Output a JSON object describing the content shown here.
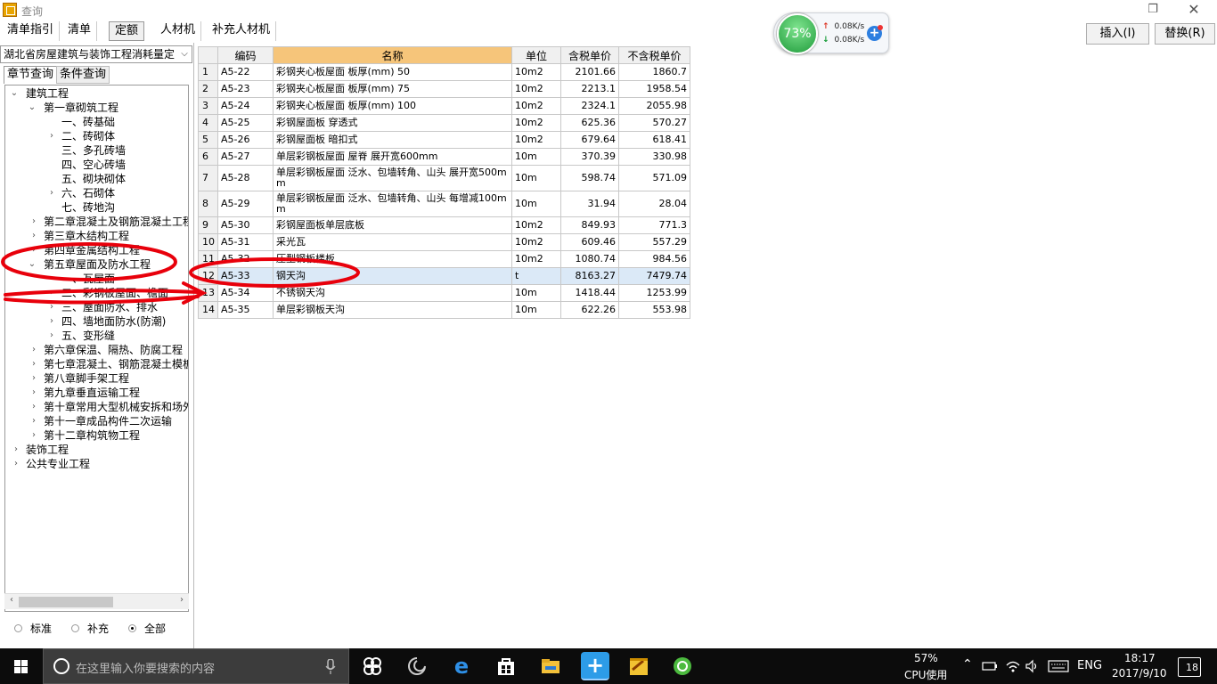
{
  "window": {
    "title": "查询"
  },
  "tabs": [
    {
      "label": "清单指引"
    },
    {
      "label": "清单"
    },
    {
      "label": "定额"
    },
    {
      "label": "人材机"
    },
    {
      "label": "补充人材机"
    }
  ],
  "actions": {
    "insert": "插入(I)",
    "replace": "替换(R)"
  },
  "net_widget": {
    "cpu_percent": "73%",
    "upload": "0.08K/s",
    "download": "0.08K/s"
  },
  "left_panel": {
    "library": "湖北省房屋建筑与装饰工程消耗量定",
    "subtabs": [
      "章节查询",
      "条件查询"
    ],
    "tree": [
      {
        "label": "建筑工程"
      },
      {
        "label": "第一章砌筑工程"
      },
      {
        "label": "一、砖基础"
      },
      {
        "label": "二、砖砌体"
      },
      {
        "label": "三、多孔砖墙"
      },
      {
        "label": "四、空心砖墙"
      },
      {
        "label": "五、砌块砌体"
      },
      {
        "label": "六、石砌体"
      },
      {
        "label": "七、砖地沟"
      },
      {
        "label": "第二章混凝土及钢筋混凝土工程"
      },
      {
        "label": "第三章木结构工程"
      },
      {
        "label": "第四章金属结构工程"
      },
      {
        "label": "第五章屋面及防水工程"
      },
      {
        "label": "一、瓦屋面"
      },
      {
        "label": "二、彩钢板屋面、檐面"
      },
      {
        "label": "三、屋面防水、排水"
      },
      {
        "label": "四、墙地面防水(防潮)"
      },
      {
        "label": "五、变形缝"
      },
      {
        "label": "第六章保温、隔热、防腐工程"
      },
      {
        "label": "第七章混凝土、钢筋混凝土模板"
      },
      {
        "label": "第八章脚手架工程"
      },
      {
        "label": "第九章垂直运输工程"
      },
      {
        "label": "第十章常用大型机械安拆和场外"
      },
      {
        "label": "第十一章成品构件二次运输"
      },
      {
        "label": "第十二章构筑物工程"
      },
      {
        "label": "装饰工程"
      },
      {
        "label": "公共专业工程"
      }
    ],
    "radios": [
      {
        "label": "标准",
        "checked": false
      },
      {
        "label": "补充",
        "checked": false
      },
      {
        "label": "全部",
        "checked": true
      }
    ]
  },
  "table": {
    "columns": [
      "",
      "编码",
      "名称",
      "单位",
      "含税单价",
      "不含税单价"
    ],
    "rows": [
      {
        "idx": "1",
        "code": "A5-22",
        "name": "彩钢夹心板屋面 板厚(mm) 50",
        "unit": "10m2",
        "price_tax": "2101.66",
        "price_notax": "1860.7"
      },
      {
        "idx": "2",
        "code": "A5-23",
        "name": "彩钢夹心板屋面 板厚(mm) 75",
        "unit": "10m2",
        "price_tax": "2213.1",
        "price_notax": "1958.54"
      },
      {
        "idx": "3",
        "code": "A5-24",
        "name": "彩钢夹心板屋面 板厚(mm) 100",
        "unit": "10m2",
        "price_tax": "2324.1",
        "price_notax": "2055.98"
      },
      {
        "idx": "4",
        "code": "A5-25",
        "name": "彩钢屋面板 穿透式",
        "unit": "10m2",
        "price_tax": "625.36",
        "price_notax": "570.27"
      },
      {
        "idx": "5",
        "code": "A5-26",
        "name": "彩钢屋面板 暗扣式",
        "unit": "10m2",
        "price_tax": "679.64",
        "price_notax": "618.41"
      },
      {
        "idx": "6",
        "code": "A5-27",
        "name": "单层彩钢板屋面 屋脊 展开宽600mm",
        "unit": "10m",
        "price_tax": "370.39",
        "price_notax": "330.98"
      },
      {
        "idx": "7",
        "code": "A5-28",
        "name": "单层彩钢板屋面 泛水、包墙转角、山头 展开宽500mm",
        "unit": "10m",
        "price_tax": "598.74",
        "price_notax": "571.09"
      },
      {
        "idx": "8",
        "code": "A5-29",
        "name": "单层彩钢板屋面 泛水、包墙转角、山头 每增减100mm",
        "unit": "10m",
        "price_tax": "31.94",
        "price_notax": "28.04"
      },
      {
        "idx": "9",
        "code": "A5-30",
        "name": "彩钢屋面板单层底板",
        "unit": "10m2",
        "price_tax": "849.93",
        "price_notax": "771.3"
      },
      {
        "idx": "10",
        "code": "A5-31",
        "name": "采光瓦",
        "unit": "10m2",
        "price_tax": "609.46",
        "price_notax": "557.29"
      },
      {
        "idx": "11",
        "code": "A5-32",
        "name": "压型钢板楼板",
        "unit": "10m2",
        "price_tax": "1080.74",
        "price_notax": "984.56"
      },
      {
        "idx": "12",
        "code": "A5-33",
        "name": "钢天沟",
        "unit": "t",
        "price_tax": "8163.27",
        "price_notax": "7479.74"
      },
      {
        "idx": "13",
        "code": "A5-34",
        "name": "不锈钢天沟",
        "unit": "10m",
        "price_tax": "1418.44",
        "price_notax": "1253.99"
      },
      {
        "idx": "14",
        "code": "A5-35",
        "name": "单层彩钢板天沟",
        "unit": "10m",
        "price_tax": "622.26",
        "price_notax": "553.98"
      }
    ]
  },
  "taskbar": {
    "search_placeholder": "在这里输入你要搜索的内容",
    "cpu_percent": "57%",
    "cpu_label": "CPU使用",
    "lang": "ENG",
    "time": "18:17",
    "date": "2017/9/10",
    "notifications": "18"
  },
  "colors": {
    "header_highlight": "#f6c57a",
    "selected_row": "#dbe9f7",
    "annotation": "#e8000b"
  }
}
